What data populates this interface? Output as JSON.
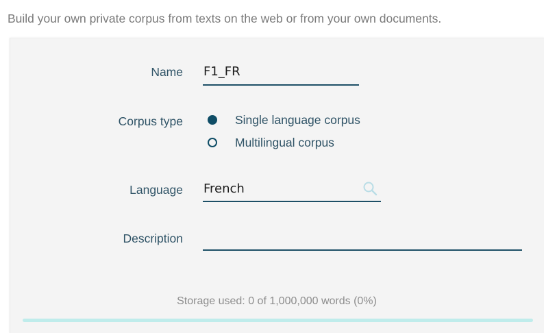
{
  "intro_text": "Build your own private corpus from texts on the web or from your own documents.",
  "form": {
    "name": {
      "label": "Name",
      "value": "F1_FR"
    },
    "corpus_type": {
      "label": "Corpus type",
      "options": [
        {
          "label": "Single language corpus",
          "selected": true
        },
        {
          "label": "Multilingual corpus",
          "selected": false
        }
      ]
    },
    "language": {
      "label": "Language",
      "value": "French",
      "icon": "search-icon"
    },
    "description": {
      "label": "Description",
      "value": ""
    }
  },
  "storage": {
    "text": "Storage used: 0 of 1,000,000 words (0%)",
    "fraction_used": 0
  },
  "colors": {
    "accent": "#0f4d66",
    "label": "#2f5366",
    "bar_track": "#bfeceb",
    "search_icon": "#b9dde6"
  }
}
